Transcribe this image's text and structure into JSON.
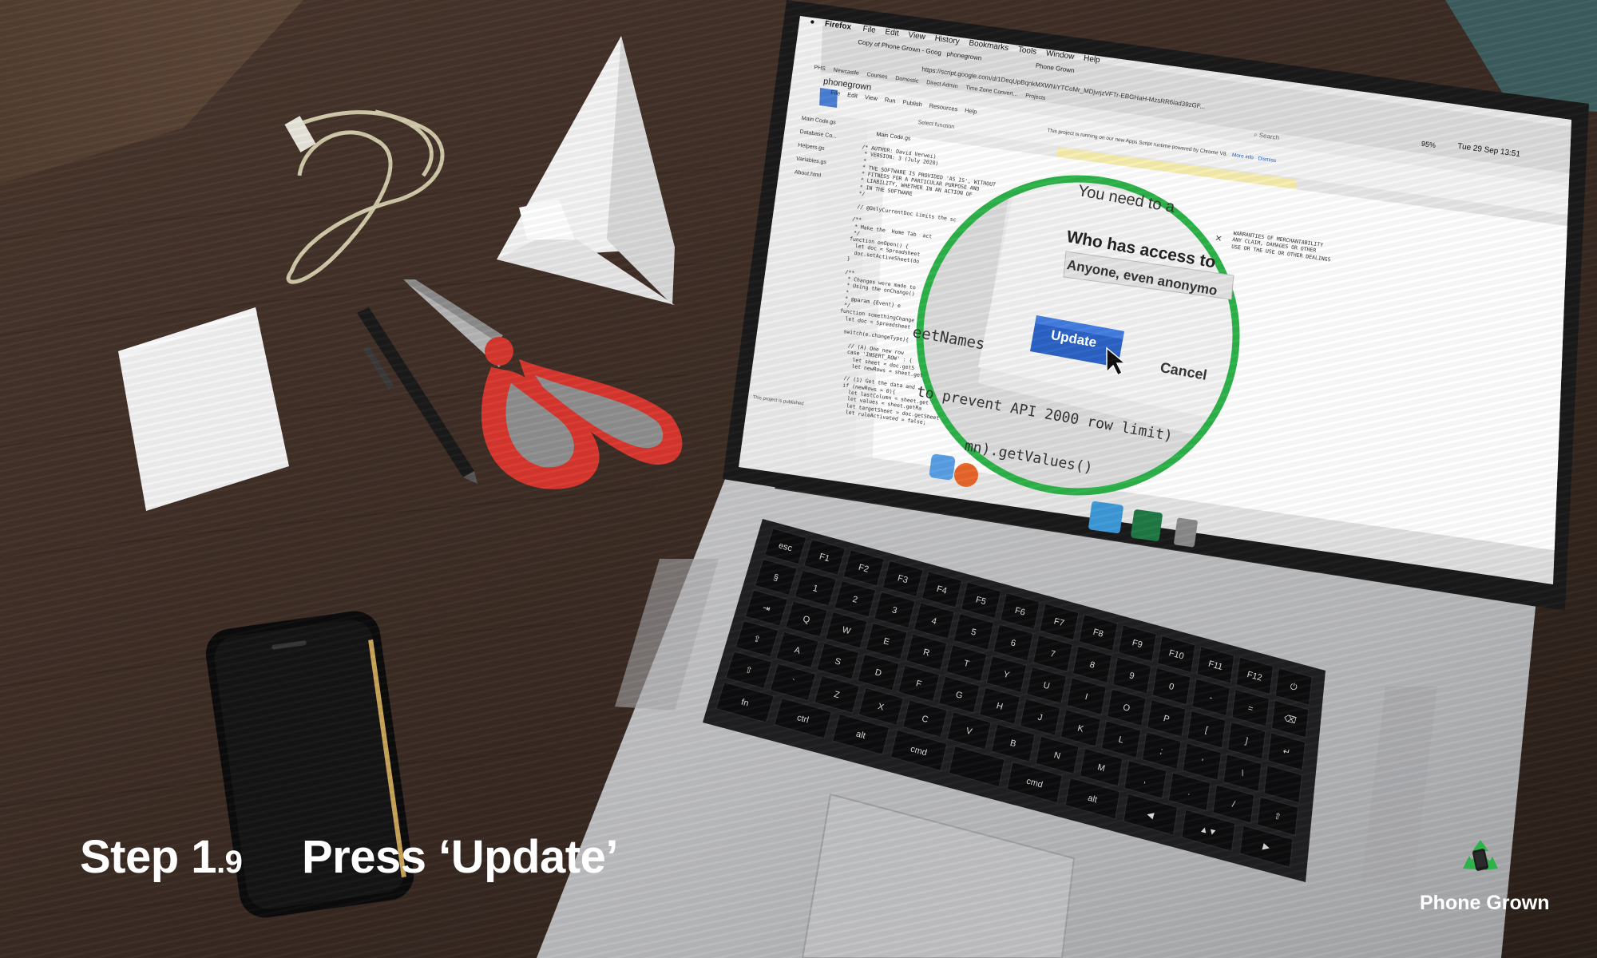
{
  "caption": {
    "step_label": "Step 1",
    "step_sub": ".9",
    "action": "Press ‘Update’"
  },
  "brand": {
    "name": "Phone Grown",
    "logo_icon": "recycle-phone-logo-icon",
    "accent": "#2db34a"
  },
  "menubar": {
    "app": "Firefox",
    "items": [
      "File",
      "Edit",
      "View",
      "History",
      "Bookmarks",
      "Tools",
      "Window",
      "Help"
    ],
    "clock": "Tue 29 Sep  13:51",
    "battery": "95%"
  },
  "browser": {
    "tabs": [
      "Copy of Phone Grown - Goog",
      "phonegrown",
      "Phone Grown"
    ],
    "url": "https://script.google.com/d/1DeqUpBqnkMXWNiYTCoMr_MDjvrjzVFTr-EBGHaH-MzsRR6iad39zGF...",
    "search_placeholder": "Search",
    "bookmarks": [
      "PHS",
      "Newcastle",
      "Courses",
      "Domestic",
      "Direct Admin",
      "Time Zone Convert...",
      "Projects"
    ]
  },
  "editor": {
    "project": "phonegrown",
    "menu": [
      "File",
      "Edit",
      "View",
      "Run",
      "Publish",
      "Resources",
      "Help"
    ],
    "select_function": "Select function",
    "file_tab": "Main Code.gs",
    "files": [
      "Main Code.gs",
      "Database Co...",
      "Helpers.gs",
      "Variables.gs",
      "About.html"
    ],
    "notice": "This project is running on our new Apps Script runtime powered by Chrome V8.",
    "notice_link": "More info",
    "notice_dismiss": "Dismiss",
    "status": "This project is published",
    "code_lines": [
      "/* AUTHOR: David Verwei)",
      " * VERSION: 3 (July 2020)",
      " *",
      " * THE SOFTWARE IS PROVIDED 'AS IS', WITHOUT",
      " * FITNESS FOR A PARTICULAR PURPOSE AND",
      " * LIABILITY, WHETHER IN AN ACTION OF",
      " * IN THE SOFTWARE",
      " */",
      "",
      " // @OnlyCurrentDoc Limits the sc",
      "",
      "/**",
      " * Make the  Home Tab  act",
      " */",
      "function onOpen() {",
      "  let doc = Spreadsheet",
      "  doc.setActiveSheet(do",
      "}",
      "",
      "/**",
      " * Changes were made to",
      " * Using the onChange()",
      " *",
      " * @param {Event} e",
      " */",
      "function somethingChange",
      "  let doc = Spreadsheet",
      "",
      "  switch(e.changeType){",
      "",
      "    // (A) One new row",
      "    case 'INSERT_ROW' : {",
      "      let sheet = doc.getS",
      "      let newRows = sheet.get",
      "",
      "    // (1) Get the data and",
      "    if (newRows > 0){",
      "      let lastColumn = sheet.get",
      "      let values = sheet.getRa",
      "      let targetSheet = doc.getSheet",
      "      let ruleActivated = false;"
    ],
    "code_right": [
      "WARRANTIES OF MERCHANTABILITY",
      "ANY CLAIM, DAMAGES OR OTHER",
      "USE OR THE USE OR OTHER DEALINGS"
    ]
  },
  "dialog": {
    "title": "You need to a",
    "question": "Who has access to",
    "access_value": "Anyone, even anonymo",
    "update_button": "Update",
    "cancel_button": "Cancel",
    "close_icon": "close-icon"
  },
  "magnified_code": {
    "line1": "eetNames",
    "line2": "to prevent API 2000 row limit)",
    "line3": "mn).getValues()"
  },
  "highlight": {
    "color": "#2db34a"
  },
  "keyboard": {
    "rows": [
      [
        "esc",
        "F1",
        "F2",
        "F3",
        "F4",
        "F5",
        "F6",
        "F7",
        "F8",
        "F9",
        "F10",
        "F11",
        "F12",
        "⏻"
      ],
      [
        "§",
        "1",
        "2",
        "3",
        "4",
        "5",
        "6",
        "7",
        "8",
        "9",
        "0",
        "-",
        "=",
        "⌫"
      ],
      [
        "⇥",
        "Q",
        "W",
        "E",
        "R",
        "T",
        "Y",
        "U",
        "I",
        "O",
        "P",
        "[",
        "]",
        "↵"
      ],
      [
        "⇪",
        "A",
        "S",
        "D",
        "F",
        "G",
        "H",
        "J",
        "K",
        "L",
        ";",
        "'",
        "\\",
        ""
      ],
      [
        "⇧",
        "`",
        "Z",
        "X",
        "C",
        "V",
        "B",
        "N",
        "M",
        ",",
        ".",
        "/",
        "⇧"
      ],
      [
        "fn",
        "ctrl",
        "alt",
        "cmd",
        "",
        "cmd",
        "alt",
        "◀",
        "▲▼",
        "▶"
      ]
    ]
  },
  "dock": [
    "finder-icon",
    "firefox-icon",
    "image-capture-icon",
    "excel-icon",
    "trash-icon"
  ]
}
